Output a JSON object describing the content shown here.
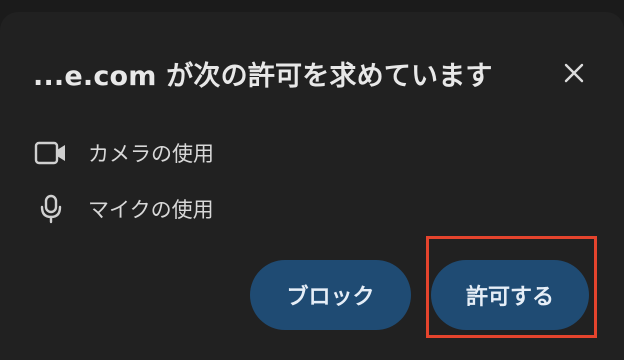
{
  "dialog": {
    "title": "...e.com が次の許可を求めています",
    "close_icon": "close-icon"
  },
  "permissions": [
    {
      "icon": "video-camera-icon",
      "label": "カメラの使用"
    },
    {
      "icon": "microphone-icon",
      "label": "マイクの使用"
    }
  ],
  "buttons": {
    "block_label": "ブロック",
    "allow_label": "許可する"
  },
  "colors": {
    "dialog_bg": "#212121",
    "button_bg": "#1f4b73",
    "highlight": "#e5442d"
  }
}
